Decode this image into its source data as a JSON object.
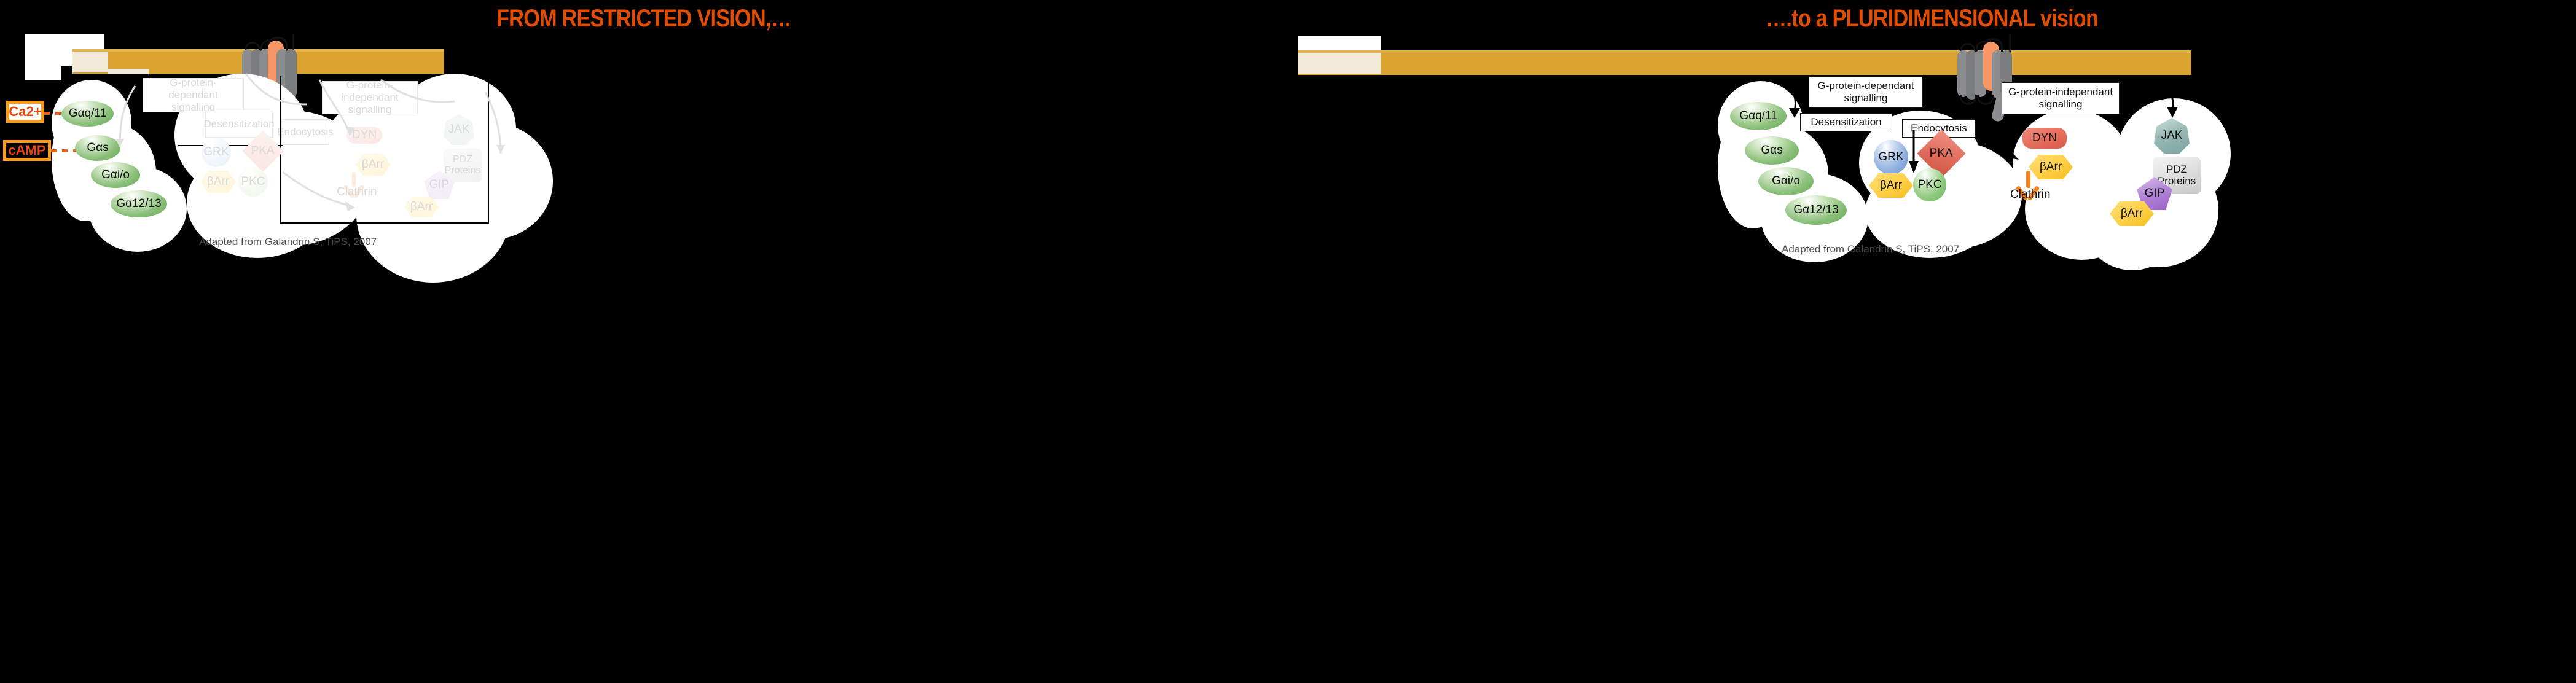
{
  "left_panel": {
    "title": "FROM RESTRICTED VISION,…",
    "attribution": "Adapted from Galandrin S, TiPS, 2007",
    "messengers": [
      {
        "label": "Ca2+",
        "style": "white"
      },
      {
        "label": "cAMP",
        "style": "black"
      }
    ],
    "label_boxes": [
      {
        "name": "g-protein-dependant",
        "line1": "G-protein-dependant",
        "line2": "signalling"
      },
      {
        "name": "desensitization",
        "line1": "Desensitization",
        "line2": ""
      },
      {
        "name": "endocytosis",
        "line1": "Endocytosis",
        "line2": ""
      },
      {
        "name": "g-protein-independant",
        "line1": "G-protein-independant",
        "line2": "signalling"
      }
    ],
    "g_proteins": [
      "Gαq/11",
      "Gαs",
      "Gαi/o",
      "Gα12/13"
    ],
    "desensitization_nodes": [
      "GRK",
      "PKA",
      "βArr",
      "PKC"
    ],
    "endocytosis_nodes": [
      "DYN",
      "βArr",
      "Clathrin"
    ],
    "independant_nodes": [
      "JAK",
      "PDZ Proteins",
      "GIP",
      "βArr"
    ]
  },
  "right_panel": {
    "title": "….to a PLURIDIMENSIONAL vision",
    "attribution": "Adapted from Galandrin S, TiPS, 2007",
    "label_boxes": [
      {
        "name": "g-protein-dependant",
        "line1": "G-protein-dependant",
        "line2": "signalling"
      },
      {
        "name": "desensitization",
        "line1": "Desensitization",
        "line2": ""
      },
      {
        "name": "endocytosis",
        "line1": "Endocytosis",
        "line2": ""
      },
      {
        "name": "g-protein-independant",
        "line1": "G-protein-independant",
        "line2": "signalling"
      }
    ],
    "g_proteins": [
      "Gαq/11",
      "Gαs",
      "Gαi/o",
      "Gα12/13"
    ],
    "desensitization_nodes": [
      "GRK",
      "PKA",
      "βArr",
      "PKC"
    ],
    "endocytosis_nodes": [
      "DYN",
      "βArr",
      "Clathrin"
    ],
    "independant_nodes": [
      "JAK",
      "PDZ Proteins",
      "GIP",
      "βArr"
    ]
  },
  "colors": {
    "background": "#000000",
    "title_orange": "#E04E06",
    "membrane": "#DBA330",
    "membrane_pale": "#F3EBD7",
    "messenger_border": "#F89A1C",
    "messenger_text": "#E8480C",
    "g_protein_green": "#8CC07B",
    "grk_blue": "#8FB0E0",
    "pka_red": "#E2705F",
    "barr_yellow": "#FFD24E",
    "pkc_green": "#8EC97E",
    "dyn_red": "#E8705F",
    "jak_teal": "#98B9B4",
    "gip_purple": "#B183D6",
    "pdz_grey": "#DCDCDC",
    "clathrin_orange": "#F58220",
    "receptor_helix": "#8B8D8F",
    "ligand_orange": "#F79768"
  }
}
